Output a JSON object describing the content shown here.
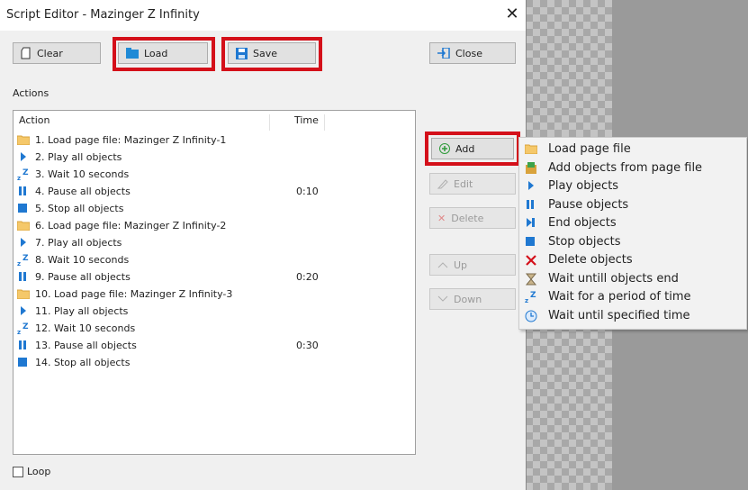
{
  "window": {
    "title": "Script Editor - Mazinger Z Infinity"
  },
  "toolbar": {
    "clear": "Clear",
    "load": "Load",
    "save": "Save",
    "close": "Close"
  },
  "actions_label": "Actions",
  "list": {
    "columns": {
      "action": "Action",
      "time": "Time"
    },
    "rows": [
      {
        "icon": "folder-icon",
        "text": "1. Load page file: Mazinger Z Infinity-1",
        "time": ""
      },
      {
        "icon": "play-icon",
        "text": "2. Play all objects",
        "time": ""
      },
      {
        "icon": "wait-icon",
        "text": "3. Wait 10 seconds",
        "time": ""
      },
      {
        "icon": "pause-icon",
        "text": "4. Pause all objects",
        "time": "0:10"
      },
      {
        "icon": "stop-icon",
        "text": "5. Stop all objects",
        "time": ""
      },
      {
        "icon": "folder-icon",
        "text": "6. Load page file: Mazinger Z Infinity-2",
        "time": ""
      },
      {
        "icon": "play-icon",
        "text": "7. Play all objects",
        "time": ""
      },
      {
        "icon": "wait-icon",
        "text": "8. Wait 10 seconds",
        "time": ""
      },
      {
        "icon": "pause-icon",
        "text": "9. Pause all objects",
        "time": "0:20"
      },
      {
        "icon": "folder-icon",
        "text": "10. Load page file: Mazinger Z Infinity-3",
        "time": ""
      },
      {
        "icon": "play-icon",
        "text": "11. Play all objects",
        "time": ""
      },
      {
        "icon": "wait-icon",
        "text": "12. Wait 10 seconds",
        "time": ""
      },
      {
        "icon": "pause-icon",
        "text": "13. Pause all objects",
        "time": "0:30"
      },
      {
        "icon": "stop-icon",
        "text": "14. Stop all objects",
        "time": ""
      }
    ]
  },
  "side": {
    "add": "Add",
    "edit": "Edit",
    "delete": "Delete",
    "up": "Up",
    "down": "Down"
  },
  "loop": {
    "label": "Loop",
    "checked": false
  },
  "menu": [
    {
      "icon": "folder-icon",
      "label": "Load page file"
    },
    {
      "icon": "add-objects-icon",
      "label": "Add objects from page file"
    },
    {
      "icon": "play-icon",
      "label": "Play objects"
    },
    {
      "icon": "pause-icon",
      "label": "Pause objects"
    },
    {
      "icon": "end-icon",
      "label": "End objects"
    },
    {
      "icon": "stop-icon",
      "label": "Stop objects"
    },
    {
      "icon": "delete-x-icon",
      "label": "Delete objects"
    },
    {
      "icon": "hourglass-icon",
      "label": "Wait untill objects end"
    },
    {
      "icon": "wait-icon",
      "label": "Wait for a period of time"
    },
    {
      "icon": "clock-icon",
      "label": "Wait until specified time"
    }
  ],
  "colors": {
    "highlight": "#d4101a",
    "accent": "#1f78d1"
  }
}
